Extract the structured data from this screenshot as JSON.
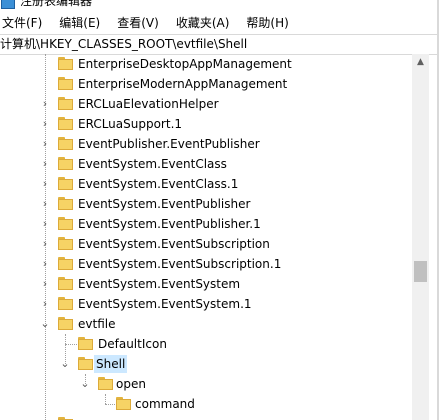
{
  "window": {
    "title": "注册表编辑器"
  },
  "menu": [
    {
      "label": "文件(F)"
    },
    {
      "label": "编辑(E)"
    },
    {
      "label": "查看(V)"
    },
    {
      "label": "收藏夹(A)"
    },
    {
      "label": "帮助(H)"
    }
  ],
  "address": {
    "path": "计算机\\HKEY_CLASSES_ROOT\\evtfile\\Shell"
  },
  "tree": [
    {
      "label": "EnterpriseDesktopAppManagement",
      "expander": "none"
    },
    {
      "label": "EnterpriseModernAppManagement",
      "expander": "none"
    },
    {
      "label": "ERCLuaElevationHelper",
      "expander": "collapsed"
    },
    {
      "label": "ERCLuaSupport.1",
      "expander": "collapsed"
    },
    {
      "label": "EventPublisher.EventPublisher",
      "expander": "collapsed"
    },
    {
      "label": "EventSystem.EventClass",
      "expander": "collapsed"
    },
    {
      "label": "EventSystem.EventClass.1",
      "expander": "collapsed"
    },
    {
      "label": "EventSystem.EventPublisher",
      "expander": "collapsed"
    },
    {
      "label": "EventSystem.EventPublisher.1",
      "expander": "collapsed"
    },
    {
      "label": "EventSystem.EventSubscription",
      "expander": "collapsed"
    },
    {
      "label": "EventSystem.EventSubscription.1",
      "expander": "collapsed"
    },
    {
      "label": "EventSystem.EventSystem",
      "expander": "collapsed"
    },
    {
      "label": "EventSystem.EventSystem.1",
      "expander": "collapsed"
    },
    {
      "label": "evtfile",
      "expander": "expanded"
    },
    {
      "label": "DefaultIcon",
      "expander": "none"
    },
    {
      "label": "Shell",
      "expander": "expanded",
      "selected": true
    },
    {
      "label": "open",
      "expander": "expanded"
    },
    {
      "label": "command",
      "expander": "none"
    },
    {
      "label": "",
      "expander": "collapsed"
    }
  ],
  "colors": {
    "selection": "#cce8ff",
    "folder": "#f6d365"
  }
}
